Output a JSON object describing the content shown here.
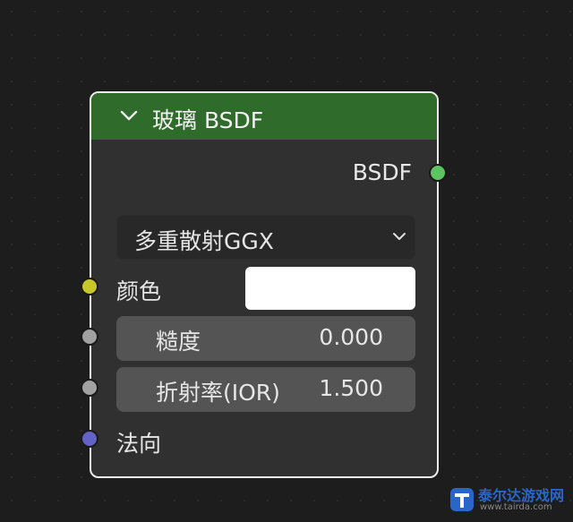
{
  "node": {
    "title": "玻璃 BSDF",
    "output_label": "BSDF",
    "distribution": "多重散射GGX",
    "inputs": {
      "color_label": "颜色",
      "color_value": "#ffffff",
      "roughness_label": "糙度",
      "roughness_value": "0.000",
      "ior_label": "折射率(IOR)",
      "ior_value": "1.500",
      "normal_label": "法向"
    },
    "socket_colors": {
      "bsdf": "#5cc461",
      "color": "#c7c729",
      "float": "#a1a1a1",
      "vector": "#6363c7"
    },
    "header_color": "#2f6b2a"
  },
  "watermark": {
    "name": "泰尔达游戏网",
    "url": "www.tairda.com"
  }
}
